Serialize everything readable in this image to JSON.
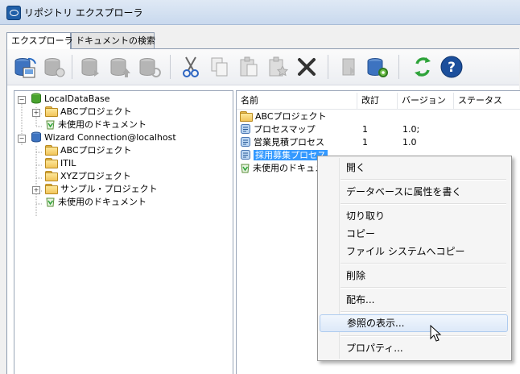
{
  "window": {
    "title": "リポジトリ エクスプローラ"
  },
  "tabs": [
    {
      "label": "エクスプローラ",
      "active": true
    },
    {
      "label": "ドキュメントの検索",
      "active": false
    }
  ],
  "toolbar": {
    "buttons": [
      {
        "icon": "connect-database-icon",
        "enabled": true
      },
      {
        "icon": "add-database-icon",
        "enabled": false
      },
      {
        "icon": "database-export-icon",
        "enabled": false
      },
      {
        "icon": "database-upload-icon",
        "enabled": false
      },
      {
        "icon": "database-refresh-icon",
        "enabled": false
      },
      {
        "icon": "cut-icon",
        "enabled": true
      },
      {
        "icon": "copy-icon",
        "enabled": false
      },
      {
        "icon": "paste-icon",
        "enabled": false
      },
      {
        "icon": "paste-special-icon",
        "enabled": false
      },
      {
        "icon": "delete-icon",
        "enabled": true
      },
      {
        "icon": "publish-icon",
        "enabled": false
      },
      {
        "icon": "database-settings-icon",
        "enabled": true
      },
      {
        "icon": "refresh-icon",
        "enabled": true
      },
      {
        "icon": "help-icon",
        "enabled": true
      }
    ]
  },
  "tree": {
    "nodes": [
      {
        "label": "LocalDataBase",
        "icon": "database-icon"
      },
      {
        "label": "ABCプロジェクト",
        "icon": "folder-icon"
      },
      {
        "label": "未使用のドキュメント",
        "icon": "recycle-bin-icon"
      },
      {
        "label": "Wizard Connection@localhost",
        "icon": "database-icon"
      },
      {
        "label": "ABCプロジェクト",
        "icon": "folder-icon"
      },
      {
        "label": "ITIL",
        "icon": "folder-icon"
      },
      {
        "label": "XYZプロジェクト",
        "icon": "folder-icon"
      },
      {
        "label": "サンプル・プロジェクト",
        "icon": "folder-icon"
      },
      {
        "label": "未使用のドキュメント",
        "icon": "recycle-bin-icon"
      }
    ]
  },
  "list": {
    "columns": [
      "名前",
      "改訂",
      "バージョン",
      "ステータス"
    ],
    "rows": [
      {
        "name": "ABCプロジェクト",
        "rev": "",
        "version": "",
        "status": "",
        "icon": "folder-icon"
      },
      {
        "name": "プロセスマップ",
        "rev": "1",
        "version": "1.0;",
        "status": "",
        "icon": "process-icon"
      },
      {
        "name": "営業見積プロセス",
        "rev": "1",
        "version": "1.0",
        "status": "",
        "icon": "process-icon"
      },
      {
        "name": "採用募集プロセス",
        "rev": "",
        "version": "",
        "status": "",
        "icon": "process-icon",
        "selected": true
      },
      {
        "name": "未使用のドキュメ",
        "rev": "",
        "version": "",
        "status": "",
        "icon": "recycle-bin-icon"
      }
    ]
  },
  "context_menu": {
    "items": [
      {
        "label": "開く"
      },
      {
        "label": "データベースに属性を書く"
      },
      {
        "label": "切り取り"
      },
      {
        "label": "コピー"
      },
      {
        "label": "ファイル システムへコピー"
      },
      {
        "label": "削除"
      },
      {
        "label": "配布..."
      },
      {
        "label": "参照の表示...",
        "hovered": true
      },
      {
        "label": "プロパティ..."
      }
    ]
  }
}
